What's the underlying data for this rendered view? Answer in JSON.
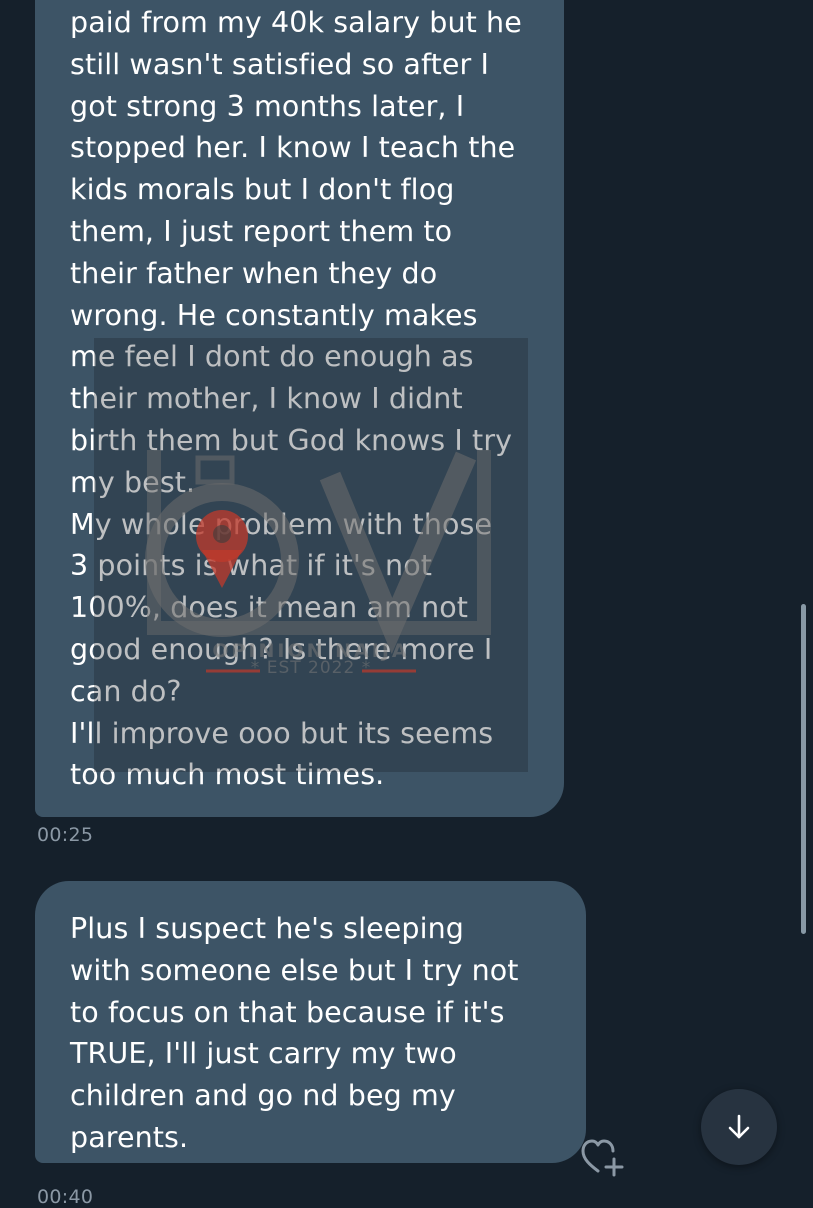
{
  "messages": [
    {
      "lines": [
        "paid from my 40k salary but he",
        "still wasn't satisfied so after I",
        "got strong 3 months later, I",
        "stopped her. I know I teach the",
        "kids morals but I don't flog",
        "them, I just report them to",
        "their father when they do",
        "wrong. He constantly makes",
        "me feel I dont do enough as",
        "their mother, I know I didnt",
        "birth them but God knows I try",
        "my best.",
        "My whole problem with those",
        "3 points is what if it's not",
        "100%, does it mean am not",
        "good enough? Is there more I",
        "can do?",
        "I'll improve ooo but its seems",
        "too much most times."
      ],
      "timestamp": "00:25"
    },
    {
      "lines": [
        "Plus I suspect he's sleeping",
        "with someone else but I try not",
        "to focus on that because if it's",
        "TRUE, I'll just carry my two",
        "children and go nd beg my",
        "parents."
      ],
      "timestamp": "00:40"
    }
  ],
  "watermark": {
    "brand": "OPINION NAIJA",
    "est": "* EST 2022 *"
  },
  "icons": {
    "react": "heart-plus-icon",
    "scroll_down": "arrow-down-icon"
  },
  "colors": {
    "background": "#15202b",
    "bubble": "#3d5466",
    "timestamp": "#8b98a5",
    "watermark_accent": "#c0392b"
  }
}
